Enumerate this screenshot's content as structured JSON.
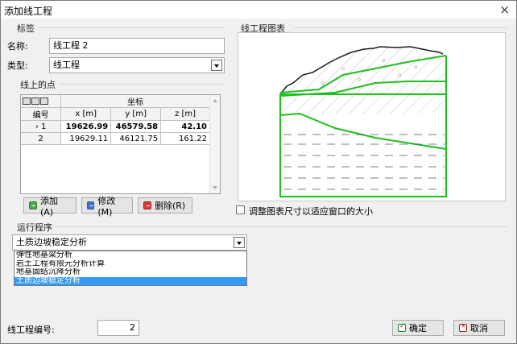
{
  "window": {
    "title": "添加线工程",
    "close_glyph": "×"
  },
  "labels_group": {
    "title": "标签",
    "name_label": "名称:",
    "name_value": "线工程 2",
    "type_label": "类型:",
    "type_value": "线工程"
  },
  "points_group": {
    "title": "线上的点",
    "header_coord": "坐标",
    "header_number": "编号",
    "col_x": "x [m]",
    "col_y": "y [m]",
    "col_z": "z [m]",
    "rows": [
      {
        "num": "1",
        "x": "19626.99",
        "y": "46579.58",
        "z": "42.10",
        "marker": "›"
      },
      {
        "num": "2",
        "x": "19629.11",
        "y": "46121.75",
        "z": "161.22",
        "marker": ""
      }
    ]
  },
  "buttons": {
    "add": "添加(A)",
    "edit": "修改(M)",
    "delete": "删除(R)",
    "ok": "确定",
    "cancel": "取消"
  },
  "preview": {
    "title": "线工程图表",
    "fit_checkbox_label": "调整图表尺寸以适应窗口的大小",
    "fit_checked": false,
    "line_color": "#1dbf1d"
  },
  "program": {
    "title": "运行程序",
    "selected": "土质边坡稳定分析",
    "options": [
      "弹性地基梁分析",
      "岩土工程有限元分析计算",
      "地基固结沉降分析",
      "土质边坡稳定分析"
    ],
    "selected_index": 3,
    "highlight_color": "#3399ff"
  },
  "footer": {
    "line_number_label": "线工程编号:",
    "line_number_value": "2"
  }
}
